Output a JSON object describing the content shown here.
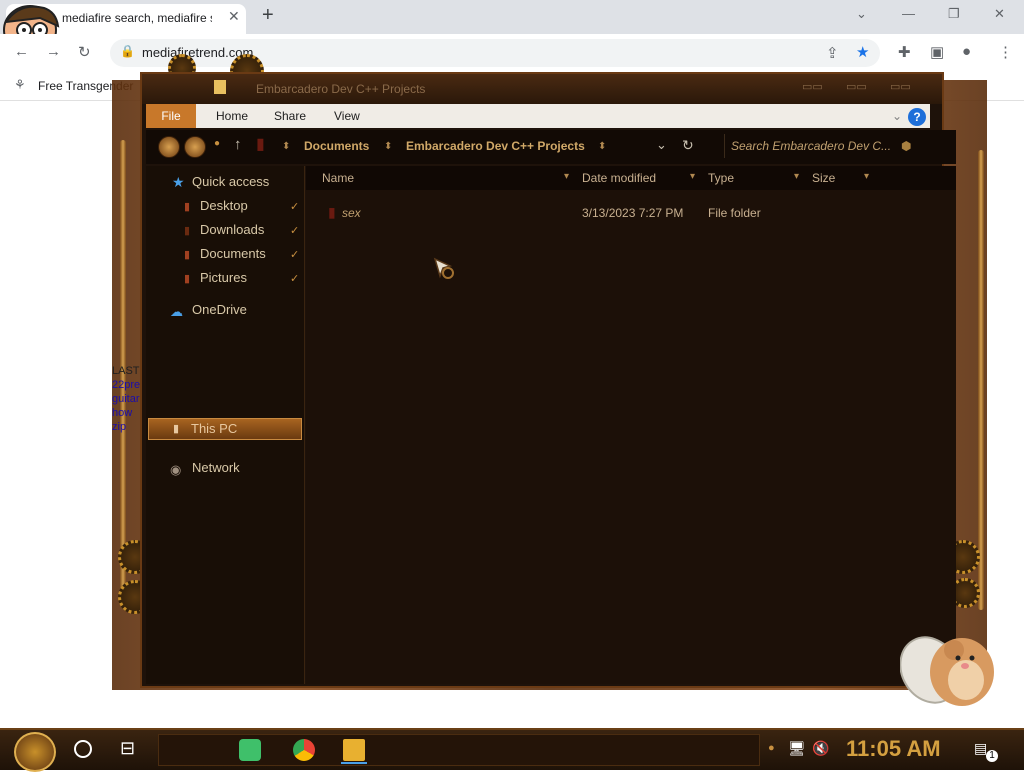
{
  "browser": {
    "tab_title": "mediafire search, mediafire se",
    "tab_close": "✕",
    "new_tab": "+",
    "url": "mediafiretrend.com",
    "bookmark": "Free Transgender",
    "controls": {
      "dropdown": "⌄",
      "minimize": "—",
      "restore": "❐",
      "close": "✕"
    }
  },
  "page": {
    "snippet": [
      "LAST",
      "22pre",
      "guitar",
      "how",
      "zip"
    ]
  },
  "explorer": {
    "title": "Embarcadero Dev C++ Projects",
    "ribbon": {
      "file": "File",
      "home": "Home",
      "share": "Share",
      "view": "View"
    },
    "breadcrumb": [
      "Documents",
      "Embarcadero Dev C++ Projects"
    ],
    "search_placeholder": "Search Embarcadero Dev C...",
    "help": "?",
    "nav": {
      "quick_access": "Quick access",
      "items": [
        "Desktop",
        "Downloads",
        "Documents",
        "Pictures"
      ],
      "onedrive": "OneDrive",
      "this_pc": "This PC",
      "network": "Network"
    },
    "columns": {
      "name": "Name",
      "date": "Date modified",
      "type": "Type",
      "size": "Size"
    },
    "files": [
      {
        "name": "sex",
        "date": "3/13/2023 7:27 PM",
        "type": "File folder",
        "size": ""
      }
    ]
  },
  "taskbar": {
    "clock": "11:05 AM",
    "notification_count": "1"
  },
  "colors": {
    "accent": "#c8782a",
    "frame": "#5a2d0c",
    "clock": "#d4a040",
    "help": "#1e6fd9"
  }
}
